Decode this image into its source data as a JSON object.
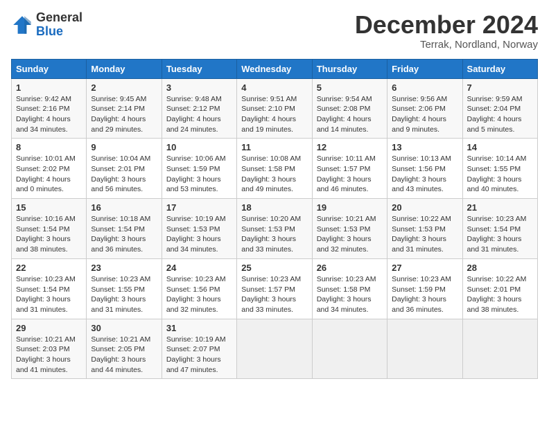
{
  "header": {
    "logo_general": "General",
    "logo_blue": "Blue",
    "month_year": "December 2024",
    "location": "Terrak, Nordland, Norway"
  },
  "days_of_week": [
    "Sunday",
    "Monday",
    "Tuesday",
    "Wednesday",
    "Thursday",
    "Friday",
    "Saturday"
  ],
  "weeks": [
    [
      {
        "day": "1",
        "sunrise": "9:42 AM",
        "sunset": "2:16 PM",
        "daylight": "4 hours and 34 minutes."
      },
      {
        "day": "2",
        "sunrise": "9:45 AM",
        "sunset": "2:14 PM",
        "daylight": "4 hours and 29 minutes."
      },
      {
        "day": "3",
        "sunrise": "9:48 AM",
        "sunset": "2:12 PM",
        "daylight": "4 hours and 24 minutes."
      },
      {
        "day": "4",
        "sunrise": "9:51 AM",
        "sunset": "2:10 PM",
        "daylight": "4 hours and 19 minutes."
      },
      {
        "day": "5",
        "sunrise": "9:54 AM",
        "sunset": "2:08 PM",
        "daylight": "4 hours and 14 minutes."
      },
      {
        "day": "6",
        "sunrise": "9:56 AM",
        "sunset": "2:06 PM",
        "daylight": "4 hours and 9 minutes."
      },
      {
        "day": "7",
        "sunrise": "9:59 AM",
        "sunset": "2:04 PM",
        "daylight": "4 hours and 5 minutes."
      }
    ],
    [
      {
        "day": "8",
        "sunrise": "10:01 AM",
        "sunset": "2:02 PM",
        "daylight": "4 hours and 0 minutes."
      },
      {
        "day": "9",
        "sunrise": "10:04 AM",
        "sunset": "2:01 PM",
        "daylight": "3 hours and 56 minutes."
      },
      {
        "day": "10",
        "sunrise": "10:06 AM",
        "sunset": "1:59 PM",
        "daylight": "3 hours and 53 minutes."
      },
      {
        "day": "11",
        "sunrise": "10:08 AM",
        "sunset": "1:58 PM",
        "daylight": "3 hours and 49 minutes."
      },
      {
        "day": "12",
        "sunrise": "10:11 AM",
        "sunset": "1:57 PM",
        "daylight": "3 hours and 46 minutes."
      },
      {
        "day": "13",
        "sunrise": "10:13 AM",
        "sunset": "1:56 PM",
        "daylight": "3 hours and 43 minutes."
      },
      {
        "day": "14",
        "sunrise": "10:14 AM",
        "sunset": "1:55 PM",
        "daylight": "3 hours and 40 minutes."
      }
    ],
    [
      {
        "day": "15",
        "sunrise": "10:16 AM",
        "sunset": "1:54 PM",
        "daylight": "3 hours and 38 minutes."
      },
      {
        "day": "16",
        "sunrise": "10:18 AM",
        "sunset": "1:54 PM",
        "daylight": "3 hours and 36 minutes."
      },
      {
        "day": "17",
        "sunrise": "10:19 AM",
        "sunset": "1:53 PM",
        "daylight": "3 hours and 34 minutes."
      },
      {
        "day": "18",
        "sunrise": "10:20 AM",
        "sunset": "1:53 PM",
        "daylight": "3 hours and 33 minutes."
      },
      {
        "day": "19",
        "sunrise": "10:21 AM",
        "sunset": "1:53 PM",
        "daylight": "3 hours and 32 minutes."
      },
      {
        "day": "20",
        "sunrise": "10:22 AM",
        "sunset": "1:53 PM",
        "daylight": "3 hours and 31 minutes."
      },
      {
        "day": "21",
        "sunrise": "10:23 AM",
        "sunset": "1:54 PM",
        "daylight": "3 hours and 31 minutes."
      }
    ],
    [
      {
        "day": "22",
        "sunrise": "10:23 AM",
        "sunset": "1:54 PM",
        "daylight": "3 hours and 31 minutes."
      },
      {
        "day": "23",
        "sunrise": "10:23 AM",
        "sunset": "1:55 PM",
        "daylight": "3 hours and 31 minutes."
      },
      {
        "day": "24",
        "sunrise": "10:23 AM",
        "sunset": "1:56 PM",
        "daylight": "3 hours and 32 minutes."
      },
      {
        "day": "25",
        "sunrise": "10:23 AM",
        "sunset": "1:57 PM",
        "daylight": "3 hours and 33 minutes."
      },
      {
        "day": "26",
        "sunrise": "10:23 AM",
        "sunset": "1:58 PM",
        "daylight": "3 hours and 34 minutes."
      },
      {
        "day": "27",
        "sunrise": "10:23 AM",
        "sunset": "1:59 PM",
        "daylight": "3 hours and 36 minutes."
      },
      {
        "day": "28",
        "sunrise": "10:22 AM",
        "sunset": "2:01 PM",
        "daylight": "3 hours and 38 minutes."
      }
    ],
    [
      {
        "day": "29",
        "sunrise": "10:21 AM",
        "sunset": "2:03 PM",
        "daylight": "3 hours and 41 minutes."
      },
      {
        "day": "30",
        "sunrise": "10:21 AM",
        "sunset": "2:05 PM",
        "daylight": "3 hours and 44 minutes."
      },
      {
        "day": "31",
        "sunrise": "10:19 AM",
        "sunset": "2:07 PM",
        "daylight": "3 hours and 47 minutes."
      },
      null,
      null,
      null,
      null
    ]
  ],
  "labels": {
    "sunrise": "Sunrise:",
    "sunset": "Sunset:",
    "daylight": "Daylight:"
  }
}
